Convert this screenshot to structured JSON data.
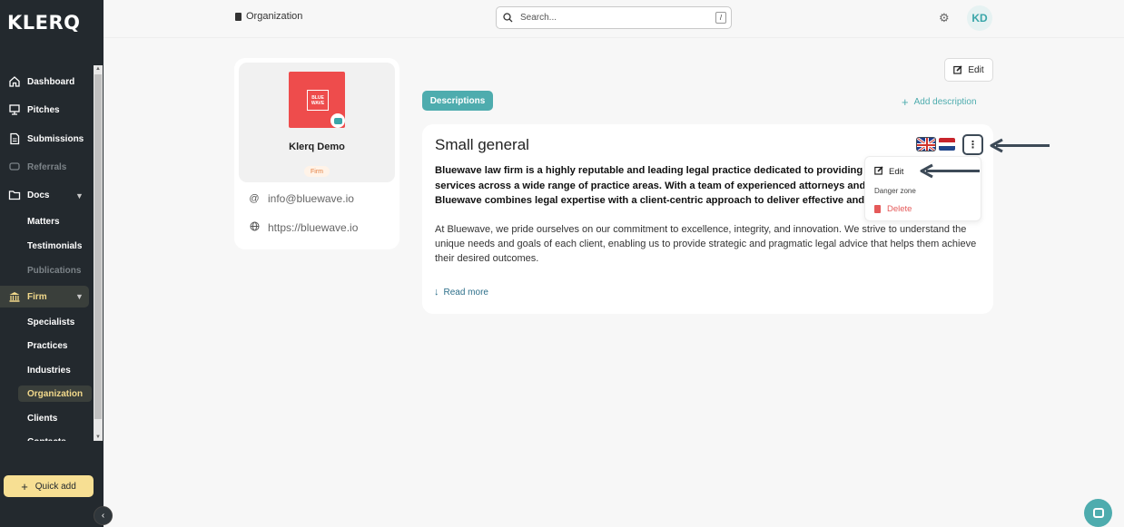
{
  "app": {
    "logo": "KLERQ"
  },
  "sidebar": {
    "items": [
      {
        "label": "Dashboard",
        "icon": "home-icon"
      },
      {
        "label": "Pitches",
        "icon": "pitches-icon"
      },
      {
        "label": "Submissions",
        "icon": "document-icon"
      },
      {
        "label": "Referrals",
        "icon": "referrals-icon"
      },
      {
        "label": "Docs",
        "icon": "folder-icon"
      }
    ],
    "docs_sub": [
      "Matters",
      "Testimonials",
      "Publications"
    ],
    "firm": {
      "label": "Firm",
      "icon": "bank-icon"
    },
    "firm_sub": [
      "Specialists",
      "Practices",
      "Industries",
      "Organization",
      "Clients",
      "Contacts"
    ],
    "quick_add": "Quick add"
  },
  "header": {
    "breadcrumb": "Organization",
    "search_placeholder": "Search...",
    "search_shortcut": "/",
    "avatar_initials": "KD"
  },
  "profile": {
    "logo_text": [
      "BLUE",
      "WAVE"
    ],
    "name": "Klerq Demo",
    "badge": "Firm",
    "email": "info@bluewave.io",
    "website": "https://bluewave.io"
  },
  "main": {
    "edit_label": "Edit",
    "tab": "Descriptions",
    "add_description": "Add description",
    "description": {
      "title": "Small general",
      "bold_lines": [
        "Bluewave law firm is a highly reputable and leading legal practice dedicated to providing",
        "services across a wide range of practice areas. With a team of experienced attorneys and",
        "Bluewave combines legal expertise with a client-centric approach to deliver effective and"
      ],
      "body": "At Bluewave, we pride ourselves on our commitment to excellence, integrity, and innovation. We strive to understand the unique needs and goals of each client, enabling us to provide strategic and pragmatic legal advice that helps them achieve their desired outcomes.",
      "read_more": "Read more"
    },
    "menu": {
      "edit": "Edit",
      "danger_zone": "Danger zone",
      "delete": "Delete"
    }
  },
  "colors": {
    "sidebar_bg": "#23292e",
    "accent": "#4eacae",
    "firm_highlight": "#f2d98b",
    "danger": "#e55a5a",
    "annotation": "#3d4a57"
  }
}
